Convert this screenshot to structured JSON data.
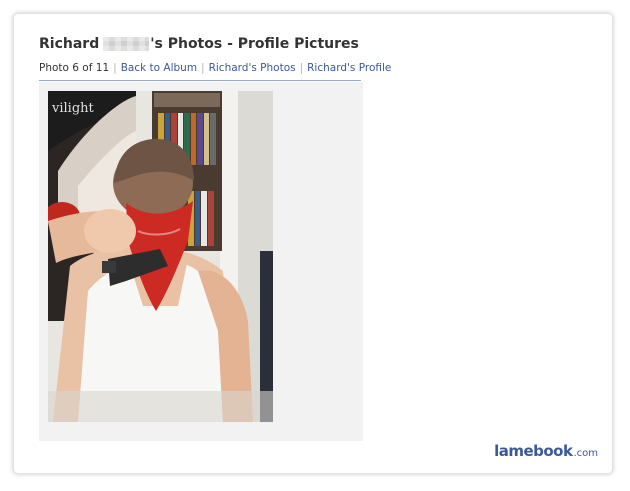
{
  "page": {
    "title_prefix": "Richard",
    "title_suffix": "'s Photos - Profile Pictures"
  },
  "nav": {
    "position": "Photo 6 of 11",
    "links": [
      "Back to Album",
      "Richard's Photos",
      "Richard's Profile"
    ]
  },
  "photo": {
    "poster_text": "vilight"
  },
  "footer": {
    "brand": "lamebook",
    "brand_suffix": ".com"
  },
  "colors": {
    "link": "#3b5998",
    "divider": "#9aa9c8",
    "title": "#333333"
  }
}
